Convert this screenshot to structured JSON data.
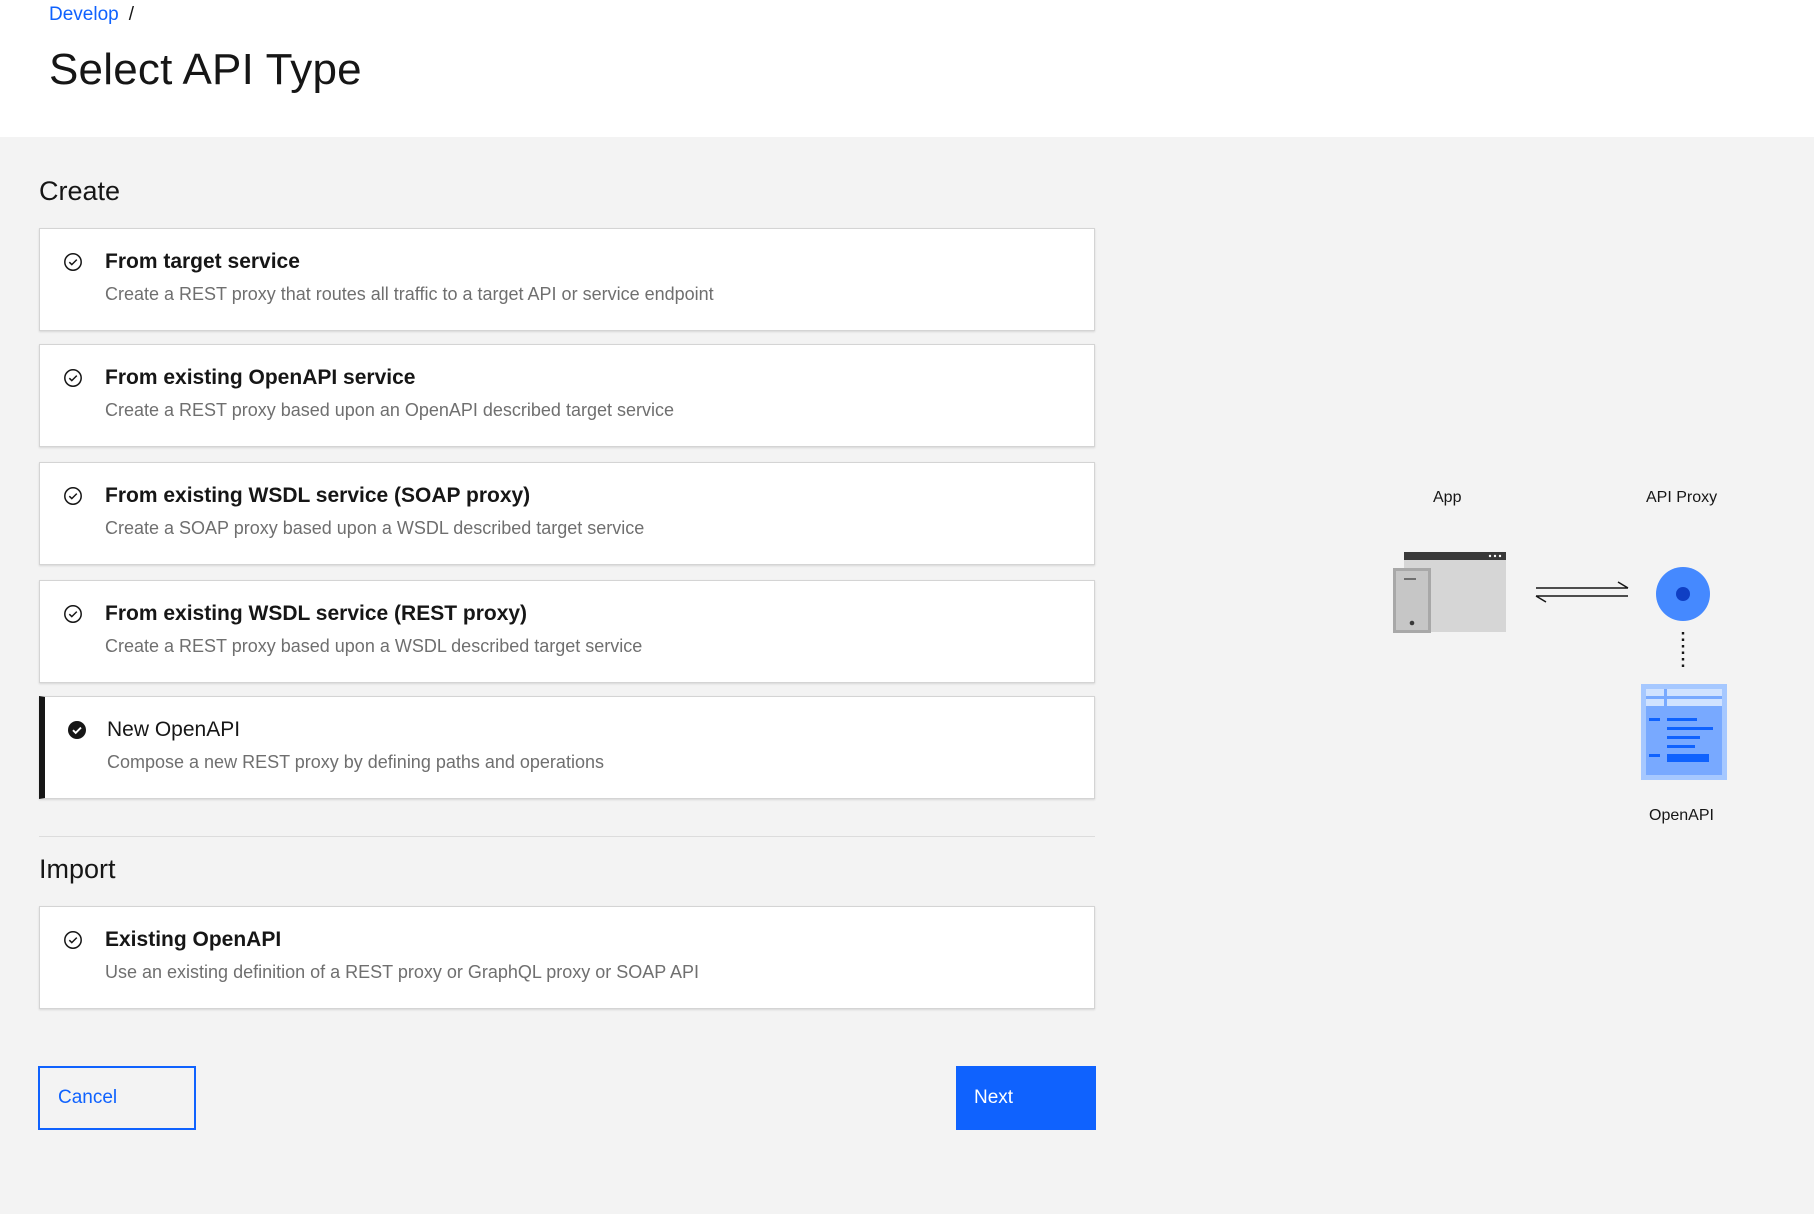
{
  "breadcrumb": {
    "link": "Develop",
    "separator": "/"
  },
  "page_title": "Select API Type",
  "sections": {
    "create": {
      "title": "Create",
      "tiles": [
        {
          "title": "From target service",
          "description": "Create a REST proxy that routes all traffic to a target API or service endpoint",
          "selected": false
        },
        {
          "title": "From existing OpenAPI service",
          "description": "Create a REST proxy based upon an OpenAPI described target service",
          "selected": false
        },
        {
          "title": "From existing WSDL service (SOAP proxy)",
          "description": "Create a SOAP proxy based upon a WSDL described target service",
          "selected": false
        },
        {
          "title": "From existing WSDL service (REST proxy)",
          "description": "Create a REST proxy based upon a WSDL described target service",
          "selected": false
        },
        {
          "title": "New OpenAPI",
          "description": "Compose a new REST proxy by defining paths and operations",
          "selected": true
        }
      ]
    },
    "import": {
      "title": "Import",
      "tiles": [
        {
          "title": "Existing OpenAPI",
          "description": "Use an existing definition of a REST proxy or GraphQL proxy or SOAP API",
          "selected": false
        }
      ]
    }
  },
  "buttons": {
    "cancel": "Cancel",
    "next": "Next"
  },
  "diagram": {
    "app_label": "App",
    "proxy_label": "API Proxy",
    "openapi_label": "OpenAPI",
    "icons": [
      "app-window-icon",
      "exchange-arrows-icon",
      "api-proxy-node-icon",
      "openapi-document-icon"
    ]
  },
  "colors": {
    "accent": "#0f62fe",
    "selected_border": "#161616",
    "description_text": "#6f6f6f",
    "background": "#f3f3f3",
    "node_fill": "#4589ff"
  }
}
